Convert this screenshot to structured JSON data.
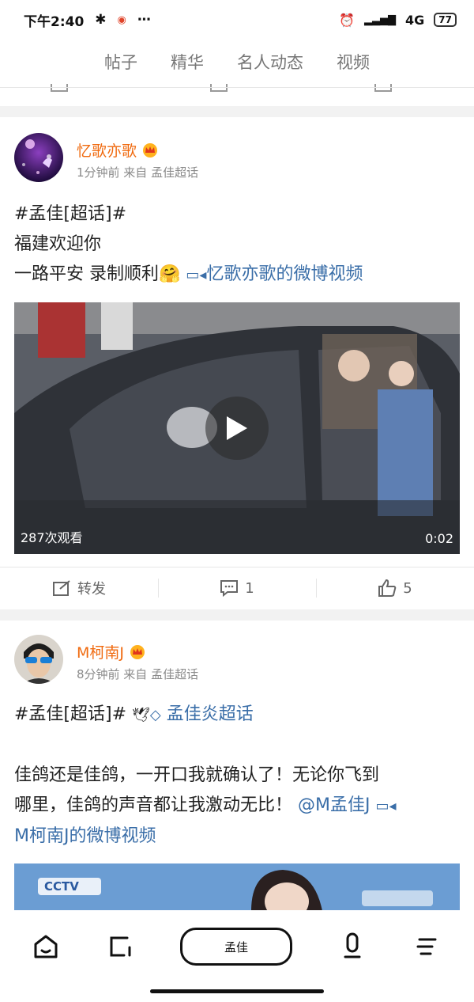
{
  "status": {
    "time": "下午2:40",
    "network": "4G",
    "battery": "77"
  },
  "tabs": [
    "帖子",
    "精华",
    "名人动态",
    "视频"
  ],
  "posts": [
    {
      "username": "忆歌亦歌",
      "meta": "1分钟前 来自 孟佳超话",
      "lines": [
        "#孟佳[超话]#",
        "福建欢迎你"
      ],
      "line3_text": "一路平安 录制顺利",
      "emoji": "🤗",
      "video_link": "忆歌亦歌的微博视频",
      "video": {
        "views": "287次观看",
        "duration": "0:02"
      },
      "actions": {
        "repost": "转发",
        "comments": "1",
        "likes": "5"
      }
    },
    {
      "username": "M柯南J",
      "meta": "8分钟前 来自 孟佳超话",
      "tag_line": "#孟佳[超话]#",
      "topic_link": "孟佳炎超话",
      "body_1": "佳鸽还是佳鸽，一开口我就确认了！无论你飞到",
      "body_2": "哪里，佳鸽的声音都让我激动无比！",
      "mention": "@M孟佳J",
      "video_link": "M柯南J的微博视频",
      "thumb_logo": "CCTV"
    }
  ],
  "bottom_nav": {
    "search": "孟佳"
  },
  "colors": {
    "username": "#f06a0f",
    "link": "#3a6ea8",
    "meta": "#8a8a8a"
  }
}
